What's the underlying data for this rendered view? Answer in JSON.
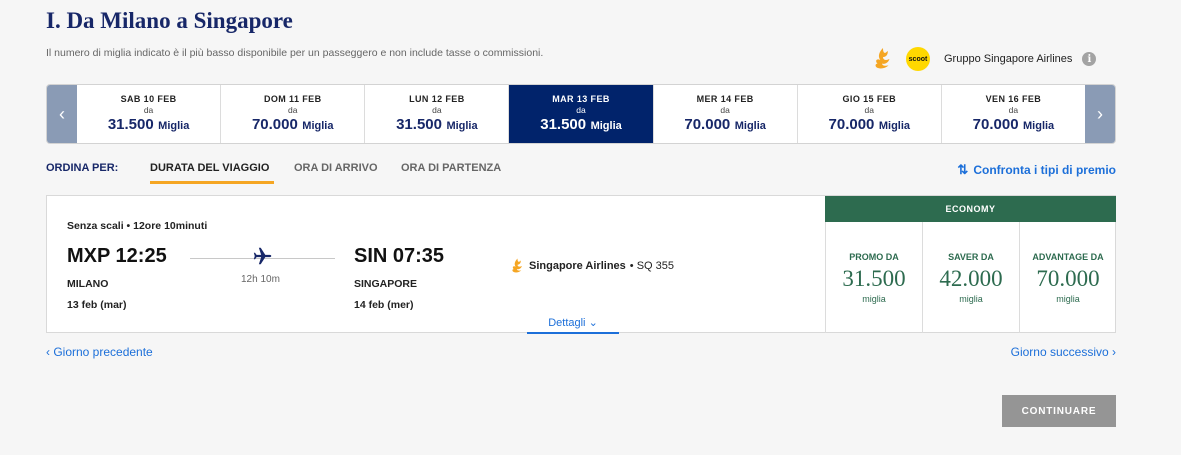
{
  "section_title": "I. Da Milano a Singapore",
  "note": "Il numero di miglia indicato è il più basso disponibile per un passeggero e non include tasse o commissioni.",
  "airline_group": {
    "label": "Gruppo Singapore Airlines",
    "scoot_logo": "scoot",
    "info_icon": "i"
  },
  "date_nav": {
    "prev_arrow": "‹",
    "next_arrow": "›",
    "days": [
      {
        "label": "SAB 10 FEB",
        "from": "da",
        "value": "31.500",
        "unit": "Miglia"
      },
      {
        "label": "DOM 11 FEB",
        "from": "da",
        "value": "70.000",
        "unit": "Miglia"
      },
      {
        "label": "LUN 12 FEB",
        "from": "da",
        "value": "31.500",
        "unit": "Miglia"
      },
      {
        "label": "MAR 13 FEB",
        "from": "da",
        "value": "31.500",
        "unit": "Miglia",
        "selected": true
      },
      {
        "label": "MER 14 FEB",
        "from": "da",
        "value": "70.000",
        "unit": "Miglia"
      },
      {
        "label": "GIO 15 FEB",
        "from": "da",
        "value": "70.000",
        "unit": "Miglia"
      },
      {
        "label": "VEN 16 FEB",
        "from": "da",
        "value": "70.000",
        "unit": "Miglia"
      }
    ]
  },
  "sort": {
    "label": "ORDINA PER:",
    "options": [
      "DURATA DEL VIAGGIO",
      "ORA DI ARRIVO",
      "ORA DI PARTENZA"
    ],
    "active": "DURATA DEL VIAGGIO",
    "compare_icon": "⇅",
    "compare": "Confronta i tipi di premio"
  },
  "flight": {
    "stops": "Senza scali • 12ore 10minuti",
    "departure": {
      "time": "MXP 12:25",
      "city": "MILANO",
      "date": "13 feb (mar)"
    },
    "arrival": {
      "time": "SIN 07:35",
      "city": "SINGAPORE",
      "date": "14 feb (mer)"
    },
    "duration": "12h 10m",
    "carrier": "Singapore Airlines",
    "flight_number": "• SQ 355",
    "details_label": "Dettagli",
    "details_chevron": "⌄"
  },
  "cabin": {
    "label": "ECONOMY",
    "fares": [
      {
        "label": "PROMO DA",
        "value": "31.500",
        "unit": "miglia"
      },
      {
        "label": "SAVER DA",
        "value": "42.000",
        "unit": "miglia"
      },
      {
        "label": "ADVANTAGE DA",
        "value": "70.000",
        "unit": "miglia"
      }
    ]
  },
  "navigation": {
    "prev_day": "‹ Giorno precedente",
    "next_day": "Giorno successivo ›"
  },
  "continue_label": "CONTINUARE",
  "colors": {
    "brand_navy": "#172768",
    "selected_day": "#01236b",
    "economy_green": "#2d6b4f",
    "link_blue": "#1c6fd9",
    "sort_accent": "#f5a623",
    "button_disabled": "#959595"
  }
}
